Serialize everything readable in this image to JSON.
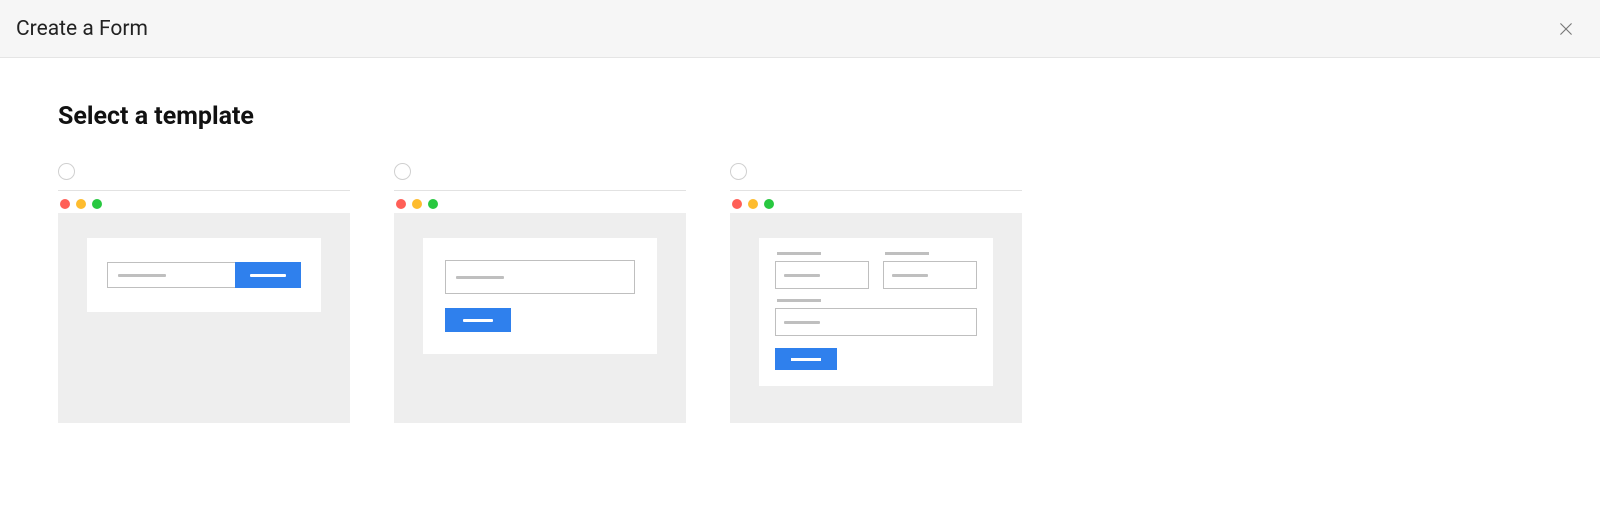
{
  "modal": {
    "title": "Create a Form"
  },
  "section": {
    "title": "Select a template"
  },
  "templates": [
    {
      "id": "inline",
      "selected": false
    },
    {
      "id": "stacked",
      "selected": false
    },
    {
      "id": "multifield",
      "selected": false
    }
  ],
  "colors": {
    "accent": "#2f80ed",
    "traffic_red": "#ff5f57",
    "traffic_yellow": "#febc2e",
    "traffic_green": "#28c840"
  }
}
